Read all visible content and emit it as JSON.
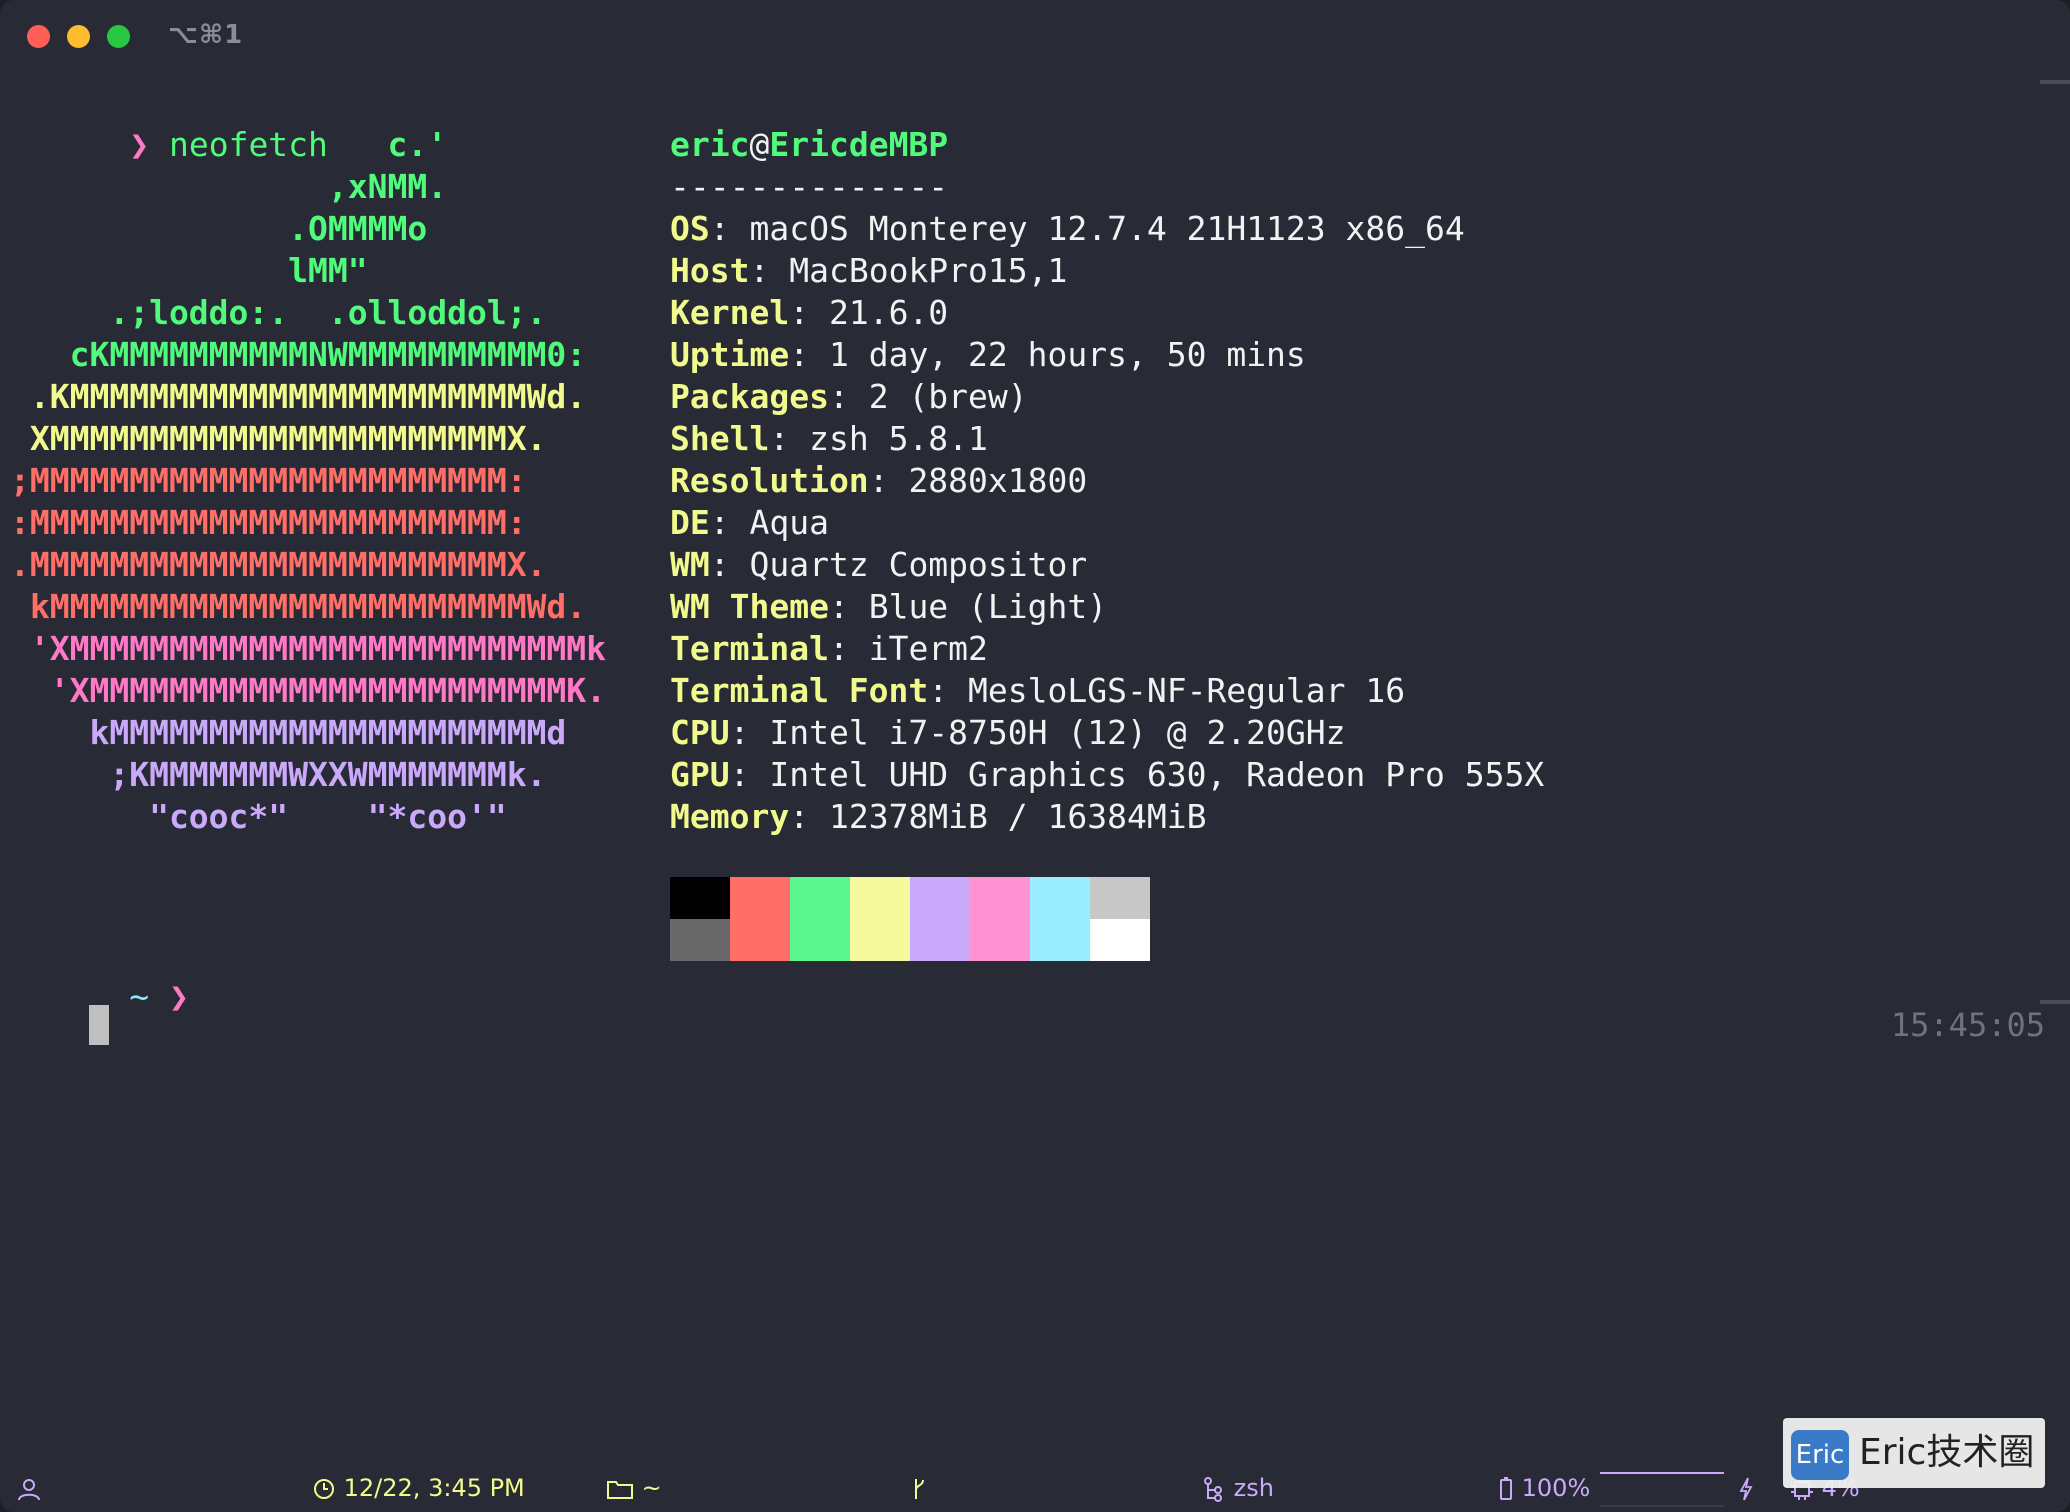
{
  "window": {
    "tab_title": "⌥⌘1"
  },
  "terminal": {
    "prompt_symbol": "❯",
    "command": "neofetch",
    "ascii_art": [
      {
        "text": "                   c.'",
        "color": "green"
      },
      {
        "text": "                ,xNMM.",
        "color": "green"
      },
      {
        "text": "              .OMMMMo",
        "color": "green"
      },
      {
        "text": "              lMM\"",
        "color": "green"
      },
      {
        "text": "     .;loddo:.  .olloddol;.",
        "color": "green"
      },
      {
        "text": "   cKMMMMMMMMMMNWMMMMMMMMMM0:",
        "color": "green"
      },
      {
        "text": " .KMMMMMMMMMMMMMMMMMMMMMMMWd.",
        "color": "yellow"
      },
      {
        "text": " XMMMMMMMMMMMMMMMMMMMMMMMX.",
        "color": "yellow"
      },
      {
        "text": ";MMMMMMMMMMMMMMMMMMMMMMMM:",
        "color": "red"
      },
      {
        "text": ":MMMMMMMMMMMMMMMMMMMMMMMM:",
        "color": "red"
      },
      {
        "text": ".MMMMMMMMMMMMMMMMMMMMMMMMX.",
        "color": "red"
      },
      {
        "text": " kMMMMMMMMMMMMMMMMMMMMMMMMWd.",
        "color": "red"
      },
      {
        "text": " 'XMMMMMMMMMMMMMMMMMMMMMMMMMMk",
        "color": "pink"
      },
      {
        "text": "  'XMMMMMMMMMMMMMMMMMMMMMMMMK.",
        "color": "pink"
      },
      {
        "text": "    kMMMMMMMMMMMMMMMMMMMMMMd",
        "color": "purple"
      },
      {
        "text": "     ;KMMMMMMMWXXWMMMMMMMk.",
        "color": "purple"
      },
      {
        "text": "       \"cooc*\"    \"*coo'\"",
        "color": "purple"
      }
    ],
    "user": "eric",
    "at": "@",
    "host": "EricdeMBP",
    "separator": "--------------",
    "info": [
      {
        "key": "OS",
        "value": "macOS Monterey 12.7.4 21H1123 x86_64"
      },
      {
        "key": "Host",
        "value": "MacBookPro15,1"
      },
      {
        "key": "Kernel",
        "value": "21.6.0"
      },
      {
        "key": "Uptime",
        "value": "1 day, 22 hours, 50 mins"
      },
      {
        "key": "Packages",
        "value": "2 (brew)"
      },
      {
        "key": "Shell",
        "value": "zsh 5.8.1"
      },
      {
        "key": "Resolution",
        "value": "2880x1800"
      },
      {
        "key": "DE",
        "value": "Aqua"
      },
      {
        "key": "WM",
        "value": "Quartz Compositor"
      },
      {
        "key": "WM Theme",
        "value": "Blue (Light)"
      },
      {
        "key": "Terminal",
        "value": "iTerm2"
      },
      {
        "key": "Terminal Font",
        "value": "MesloLGS-NF-Regular 16"
      },
      {
        "key": "CPU",
        "value": "Intel i7-8750H (12) @ 2.20GHz"
      },
      {
        "key": "GPU",
        "value": "Intel UHD Graphics 630, Radeon Pro 555X"
      },
      {
        "key": "Memory",
        "value": "12378MiB / 16384MiB"
      }
    ],
    "palette": {
      "top": [
        "#000000",
        "#ff6e67",
        "#5af78e",
        "#f4f99d",
        "#caa9fa",
        "#ff92d0",
        "#9aedfe",
        "#c7c7c7"
      ],
      "bottom": [
        "#686868",
        "#ff6e67",
        "#5af78e",
        "#f4f99d",
        "#caa9fa",
        "#ff92d0",
        "#9aedfe",
        "#ffffff"
      ]
    },
    "cwd": "~",
    "right_prompt_time": "15:45:05"
  },
  "statusbar": {
    "datetime": "12/22, 3:45 PM",
    "directory": "~",
    "job": "zsh",
    "battery": "100%",
    "cpu": "4%"
  },
  "watermark": {
    "logo": "Eric",
    "text": "Eric技术圈"
  }
}
